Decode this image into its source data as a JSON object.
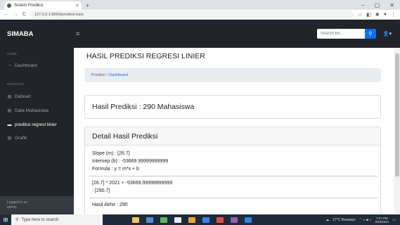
{
  "browser": {
    "tab_title": "Sistem Prediksi",
    "tab_close": "×",
    "new_tab": "+",
    "url": "127.0.0.1:8000/prediksi-train",
    "nav_back": "←",
    "nav_forward": "→",
    "nav_reload": "C",
    "window_controls": [
      "–",
      "▢",
      "✕"
    ]
  },
  "navbar": {
    "brand": "SIMABA",
    "menu_icon": "≡",
    "search_placeholder": "Search for...",
    "search_icon": "🔍",
    "user_icon": "👤▾"
  },
  "sidebar": {
    "core_heading": "CORE",
    "dashboard": "Dashboard",
    "prodi_heading": "PRODIKSI",
    "items": [
      {
        "label": "Dataset",
        "icon": "▤"
      },
      {
        "label": "Data Mahasiswa",
        "icon": "▤"
      },
      {
        "label": "prediksi regresi linier",
        "icon": "▬"
      },
      {
        "label": "Grafik",
        "icon": "▤"
      }
    ],
    "logged_in_label": "Logged in as:",
    "logged_in_user": "admin"
  },
  "main": {
    "page_title": "HASIL PREDIKSI REGRESI LINIER",
    "breadcrumb": {
      "first": "Prediksi",
      "separator": "/",
      "second": "Dashboard"
    },
    "result_card": "Hasil Prediksi : 290 Mahasiswa",
    "detail": {
      "title": "Detail Hasil Prediksi",
      "slope": "Slope (m) : [26.7]",
      "intercept": "Intersep (b) : -53669.99999999999",
      "formula": "Formula : y = m*x + b",
      "calc": "[26.7] * 2021 + -53669.99999999999",
      "calc_result": ": [290.7]",
      "final_partial": "Hasil Akhir : 290"
    }
  },
  "taskbar": {
    "search_placeholder": "Type here to search",
    "weather": "27°C Berawan",
    "time": "7:07 PM",
    "date": "3/29/2021"
  }
}
